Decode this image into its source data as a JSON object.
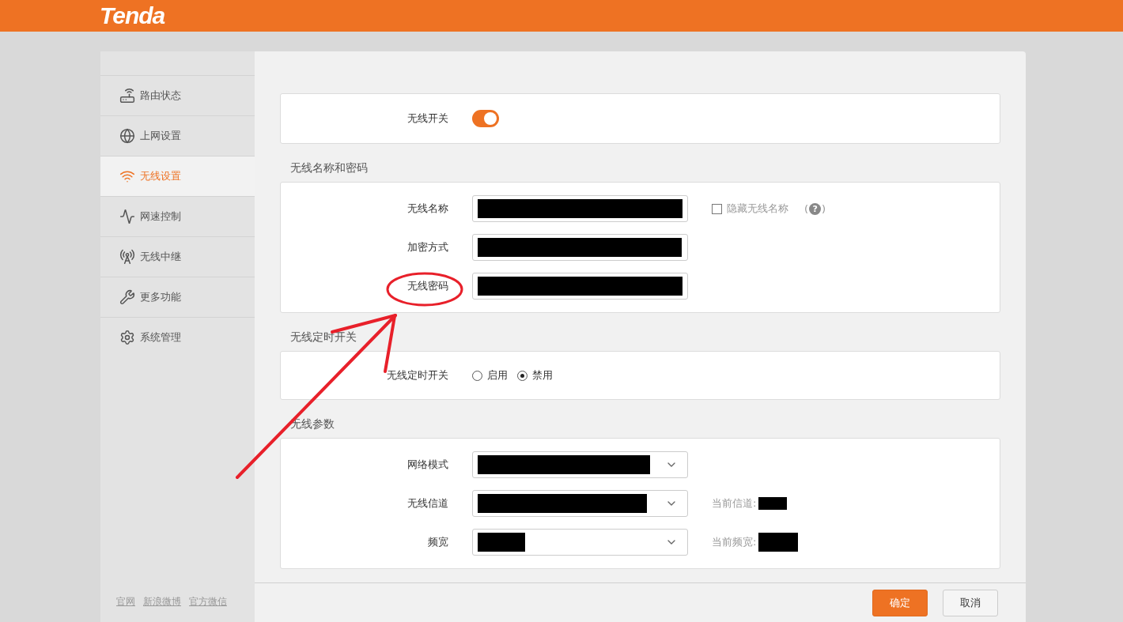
{
  "header": {
    "logo": "Tenda"
  },
  "sidebar": {
    "items": [
      {
        "label": "路由状态",
        "selected": false
      },
      {
        "label": "上网设置",
        "selected": false
      },
      {
        "label": "无线设置",
        "selected": true
      },
      {
        "label": "网速控制",
        "selected": false
      },
      {
        "label": "无线中继",
        "selected": false
      },
      {
        "label": "更多功能",
        "selected": false
      },
      {
        "label": "系统管理",
        "selected": false
      }
    ],
    "links": [
      "官网",
      "新浪微博",
      "官方微信"
    ]
  },
  "wireless_switch": {
    "label": "无线开关",
    "on": true
  },
  "name_password": {
    "title": "无线名称和密码",
    "rows": [
      {
        "label": "无线名称",
        "redacted": true
      },
      {
        "label": "加密方式",
        "redacted": true
      },
      {
        "label": "无线密码",
        "redacted": true
      }
    ],
    "hide_ssid": {
      "label": "隐藏无线名称",
      "checked": false
    },
    "help": {
      "open": "(",
      "mark": "?",
      "close": ")"
    }
  },
  "schedule": {
    "title": "无线定时开关",
    "label": "无线定时开关",
    "options": [
      {
        "label": "启用",
        "selected": false
      },
      {
        "label": "禁用",
        "selected": true
      }
    ]
  },
  "params": {
    "title": "无线参数",
    "rows": [
      {
        "label": "网络模式",
        "redacted": true
      },
      {
        "label": "无线信道",
        "redacted": true,
        "note": "当前信道:"
      },
      {
        "label": "频宽",
        "redacted": true,
        "note": "当前频宽:"
      }
    ]
  },
  "buttons": [
    {
      "label": "确定",
      "kind": "primary"
    },
    {
      "label": "取消",
      "kind": "secondary"
    }
  ]
}
